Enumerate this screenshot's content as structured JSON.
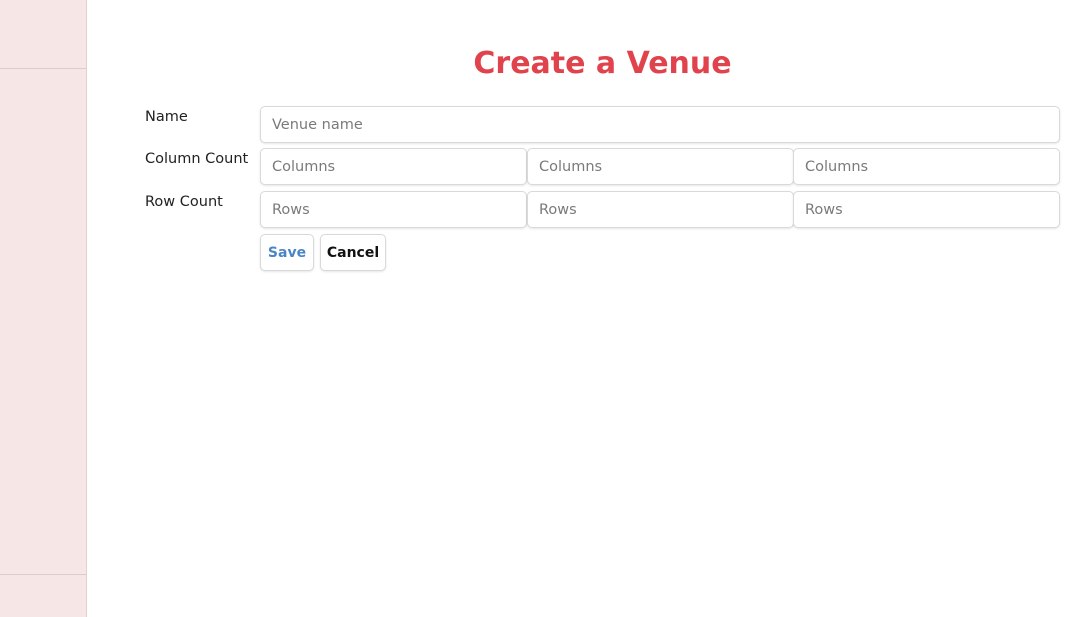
{
  "page": {
    "title": "Create a Venue",
    "accent_color": "#e0434c"
  },
  "form": {
    "name_label": "Name",
    "name_placeholder": "Venue name",
    "column_count_label": "Column Count",
    "column_placeholders": [
      "Columns",
      "Columns",
      "Columns"
    ],
    "row_count_label": "Row Count",
    "row_placeholders": [
      "Rows",
      "Rows",
      "Rows"
    ],
    "save_label": "Save",
    "cancel_label": "Cancel",
    "save_color": "#4a86c5"
  }
}
